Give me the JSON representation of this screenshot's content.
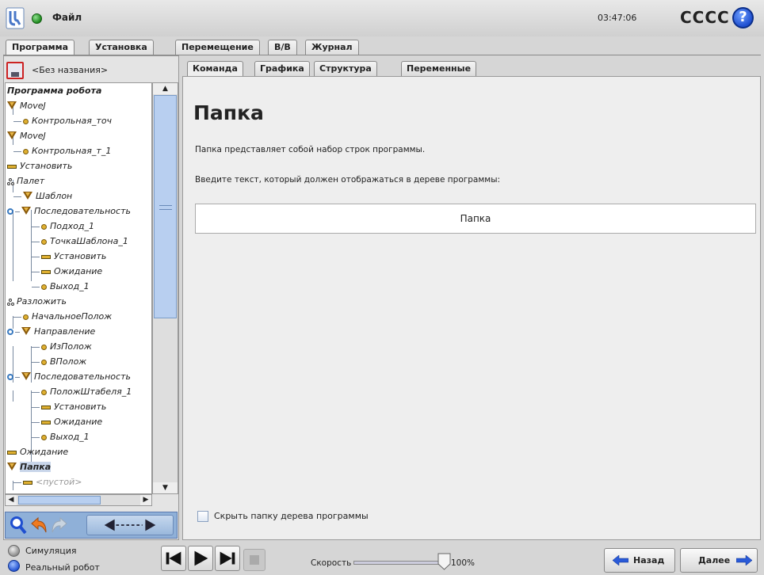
{
  "header": {
    "file_menu": "Файл",
    "clock": "03:47:06",
    "robot_name": "CCCC",
    "help_symbol": "?"
  },
  "main_tabs": [
    "Программа",
    "Установка",
    "Перемещение",
    "В/В",
    "Журнал"
  ],
  "program": {
    "name": "<Без названия>"
  },
  "sub_tabs": [
    "Команда",
    "Графика",
    "Структура",
    "Переменные"
  ],
  "tree": {
    "items": [
      {
        "label": "Программа робота",
        "icon": "none"
      },
      {
        "label": "MoveJ",
        "icon": "movej-icon"
      },
      {
        "label": "Контрольная_точ",
        "icon": "waypoint-icon"
      },
      {
        "label": "MoveJ",
        "icon": "movej-icon"
      },
      {
        "label": "Контрольная_т_1",
        "icon": "waypoint-icon"
      },
      {
        "label": "Установить",
        "icon": "set-icon"
      },
      {
        "label": "Палет",
        "icon": "pallet-icon"
      },
      {
        "label": "Шаблон",
        "icon": "folder-icon"
      },
      {
        "label": "Последовательность",
        "icon": "folder-icon"
      },
      {
        "label": "Подход_1",
        "icon": "waypoint-icon"
      },
      {
        "label": "ТочкаШаблона_1",
        "icon": "waypoint-icon"
      },
      {
        "label": "Установить",
        "icon": "set-icon"
      },
      {
        "label": "Ожидание",
        "icon": "wait-icon"
      },
      {
        "label": "Выход_1",
        "icon": "waypoint-icon"
      },
      {
        "label": "Разложить",
        "icon": "pallet-icon"
      },
      {
        "label": "НачальноеПолож",
        "icon": "waypoint-icon"
      },
      {
        "label": "Направление",
        "icon": "folder-icon"
      },
      {
        "label": "ИзПолож",
        "icon": "waypoint-icon"
      },
      {
        "label": "ВПолож",
        "icon": "waypoint-icon"
      },
      {
        "label": "Последовательность",
        "icon": "folder-icon"
      },
      {
        "label": "ПоложШтабеля_1",
        "icon": "waypoint-icon"
      },
      {
        "label": "Установить",
        "icon": "set-icon"
      },
      {
        "label": "Ожидание",
        "icon": "wait-icon"
      },
      {
        "label": "Выход_1",
        "icon": "waypoint-icon"
      },
      {
        "label": "Ожидание",
        "icon": "wait-icon"
      },
      {
        "label": "Папка",
        "icon": "folder-icon"
      },
      {
        "label": "<пустой>",
        "icon": "empty-icon"
      }
    ]
  },
  "command": {
    "title": "Папка",
    "description": "Папка представляет собой набор строк программы.",
    "prompt": "Введите текст, который должен отображаться в дереве программы:",
    "folder_name_value": "Папка",
    "hide_checkbox_label": "Скрыть папку дерева программы",
    "hide_checked": false
  },
  "footer": {
    "simulation_label": "Симуляция",
    "real_robot_label": "Реальный робот",
    "selected_mode": "Реальный робот",
    "speed_label": "Скорость",
    "speed_value": "100%",
    "speed_fraction": 1.0,
    "back_label": "Назад",
    "next_label": "Далее"
  },
  "colors": {
    "accent_blue": "#1f4fd0",
    "tree_icon_gold": "#e0b030",
    "selection": "#c9d6ea",
    "toolbar_blue": "#8fb0d8"
  }
}
